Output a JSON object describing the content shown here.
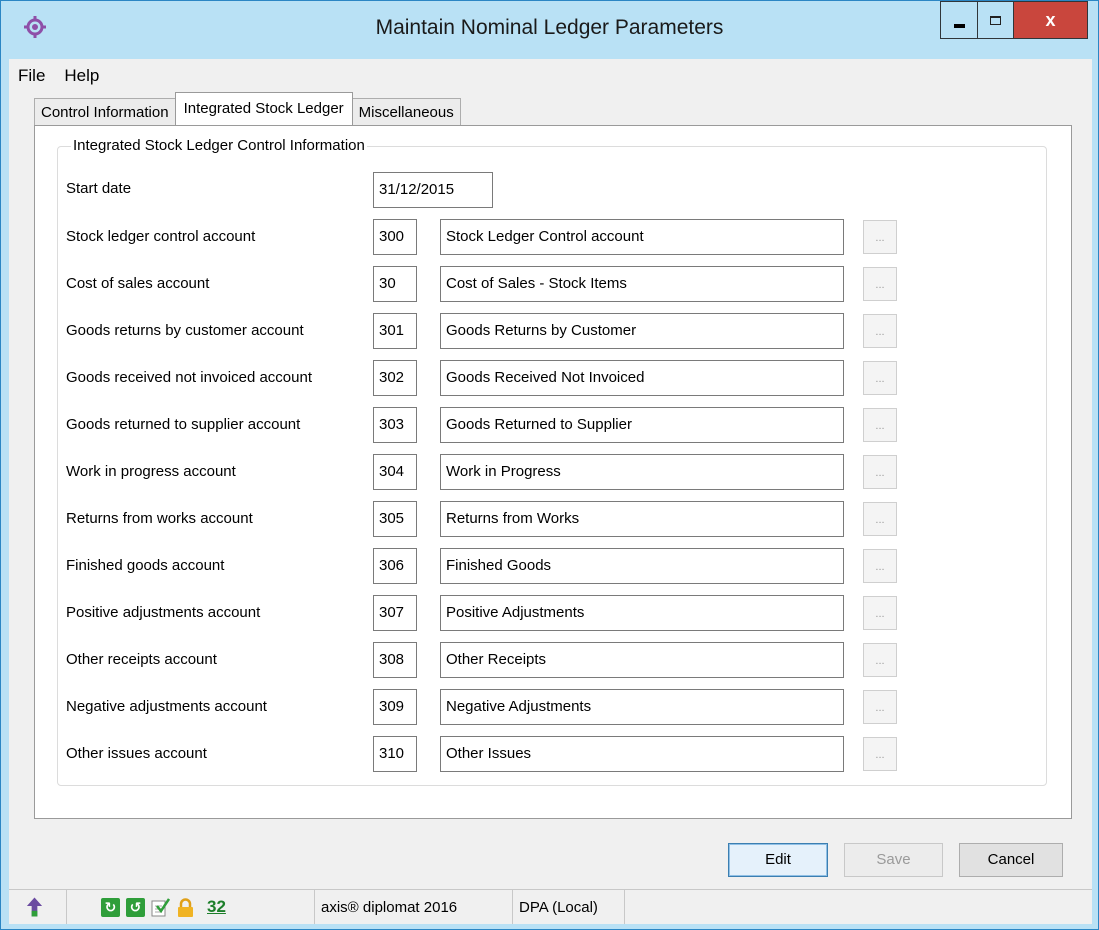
{
  "window": {
    "title": "Maintain Nominal Ledger Parameters",
    "close_glyph": "x"
  },
  "menu": [
    {
      "label": "File"
    },
    {
      "label": "Help"
    }
  ],
  "tabs": [
    {
      "label": "Control Information",
      "active": false
    },
    {
      "label": "Integrated Stock Ledger",
      "active": true
    },
    {
      "label": "Miscellaneous",
      "active": false
    }
  ],
  "group": {
    "title": "Integrated Stock Ledger Control Information",
    "start_date_label": "Start date",
    "start_date_value": "31/12/2015",
    "lookup_glyph": "...",
    "rows": [
      {
        "label": "Stock ledger control account",
        "code": "300",
        "desc": "Stock Ledger Control account"
      },
      {
        "label": "Cost of sales account",
        "code": "30",
        "desc": "Cost of Sales - Stock Items"
      },
      {
        "label": "Goods returns by customer account",
        "code": "301",
        "desc": "Goods Returns by Customer"
      },
      {
        "label": "Goods received not invoiced account",
        "code": "302",
        "desc": "Goods Received Not Invoiced"
      },
      {
        "label": "Goods returned to supplier account",
        "code": "303",
        "desc": "Goods Returned to Supplier"
      },
      {
        "label": "Work in progress account",
        "code": "304",
        "desc": "Work in Progress"
      },
      {
        "label": "Returns from works account",
        "code": "305",
        "desc": "Returns from Works"
      },
      {
        "label": "Finished goods account",
        "code": "306",
        "desc": "Finished Goods"
      },
      {
        "label": "Positive adjustments account",
        "code": "307",
        "desc": "Positive Adjustments"
      },
      {
        "label": "Other receipts account",
        "code": "308",
        "desc": "Other Receipts"
      },
      {
        "label": "Negative adjustments account",
        "code": "309",
        "desc": "Negative Adjustments"
      },
      {
        "label": "Other issues account",
        "code": "310",
        "desc": "Other Issues"
      }
    ]
  },
  "buttons": {
    "edit": "Edit",
    "save": "Save",
    "cancel": "Cancel"
  },
  "statusbar": {
    "count": "32",
    "product": "axis® diplomat 2016",
    "connection": "DPA (Local)"
  },
  "colors": {
    "frame": "#58b6e8",
    "close_button": "#c9463d",
    "status_green": "#2f9e3a"
  }
}
